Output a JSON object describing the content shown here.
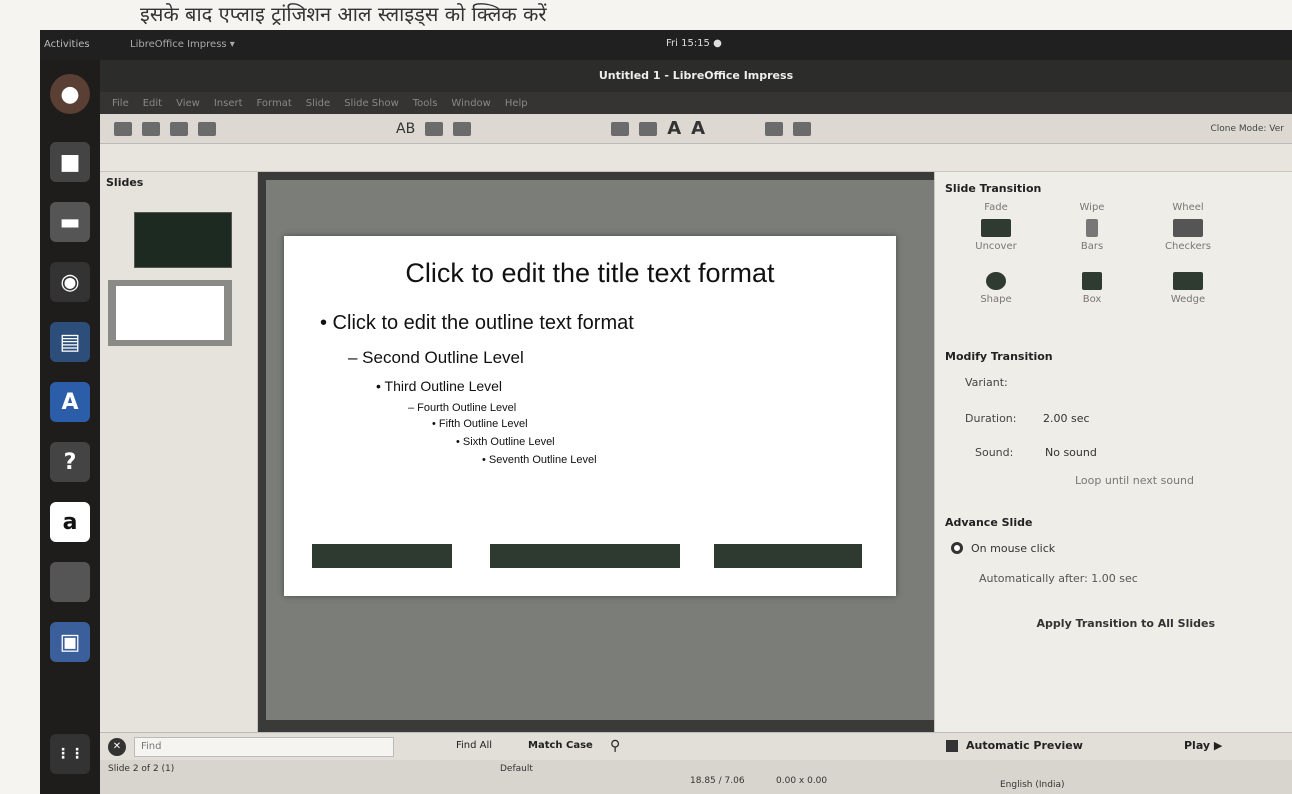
{
  "caption": "इसके बाद एप्लाइ ट्रांजिशन आल स्लाइड्स को क्लिक करें",
  "topbar": {
    "activities": "Activities",
    "app_menu": "LibreOffice Impress ▾",
    "clock": "Fri 15:15 ●"
  },
  "window": {
    "title": "Untitled 1 - LibreOffice Impress"
  },
  "menu": [
    "File",
    "Edit",
    "View",
    "Insert",
    "Format",
    "Slide",
    "Slide Show",
    "Tools",
    "Window",
    "Help"
  ],
  "toolbar": {
    "font_a1": "A",
    "font_a2": "A",
    "ab": "AB",
    "clone": "Clone Mode: Ver"
  },
  "slides_pane": {
    "header": "Slides"
  },
  "slide": {
    "title": "Click to edit the title text format",
    "outline": [
      "• Click to edit the outline text format",
      "– Second Outline Level",
      "• Third Outline Level",
      "– Fourth Outline Level",
      "• Fifth Outline Level",
      "• Sixth Outline Level",
      "• Seventh Outline Level"
    ]
  },
  "sidebar": {
    "slide_transition": "Slide Transition",
    "transitions": [
      {
        "label": "Fade",
        "caption": "Uncover"
      },
      {
        "label": "Wipe",
        "caption": "Bars"
      },
      {
        "label": "Wheel",
        "caption": "Checkers"
      },
      {
        "label": "Shape",
        "caption": ""
      },
      {
        "label": "Box",
        "caption": ""
      },
      {
        "label": "Wedge",
        "caption": ""
      }
    ],
    "modify_transition": "Modify Transition",
    "variant_label": "Variant:",
    "duration_label": "Duration:",
    "duration_value": "2.00 sec",
    "sound_label": "Sound:",
    "sound_value": "No sound",
    "loop_label": "Loop until next sound",
    "advance_slide": "Advance Slide",
    "on_mouse_click": "On mouse click",
    "automatically_after": "Automatically after: 1.00 sec",
    "apply_all": "Apply Transition to All Slides",
    "automatic_preview": "Automatic Preview",
    "play": "Play ▶"
  },
  "findbar": {
    "placeholder": "Find",
    "find_all": "Find All",
    "match_case": "Match Case"
  },
  "status": {
    "slide_count": "Slide 2 of 2 (1)",
    "layout": "Default",
    "position": "18.85 / 7.06",
    "size": "0.00 x 0.00",
    "language": "English (India)"
  },
  "colors": {
    "launcher": "#1e1d1c",
    "topbar": "#202020",
    "slide_footer": "#2e3a30"
  }
}
